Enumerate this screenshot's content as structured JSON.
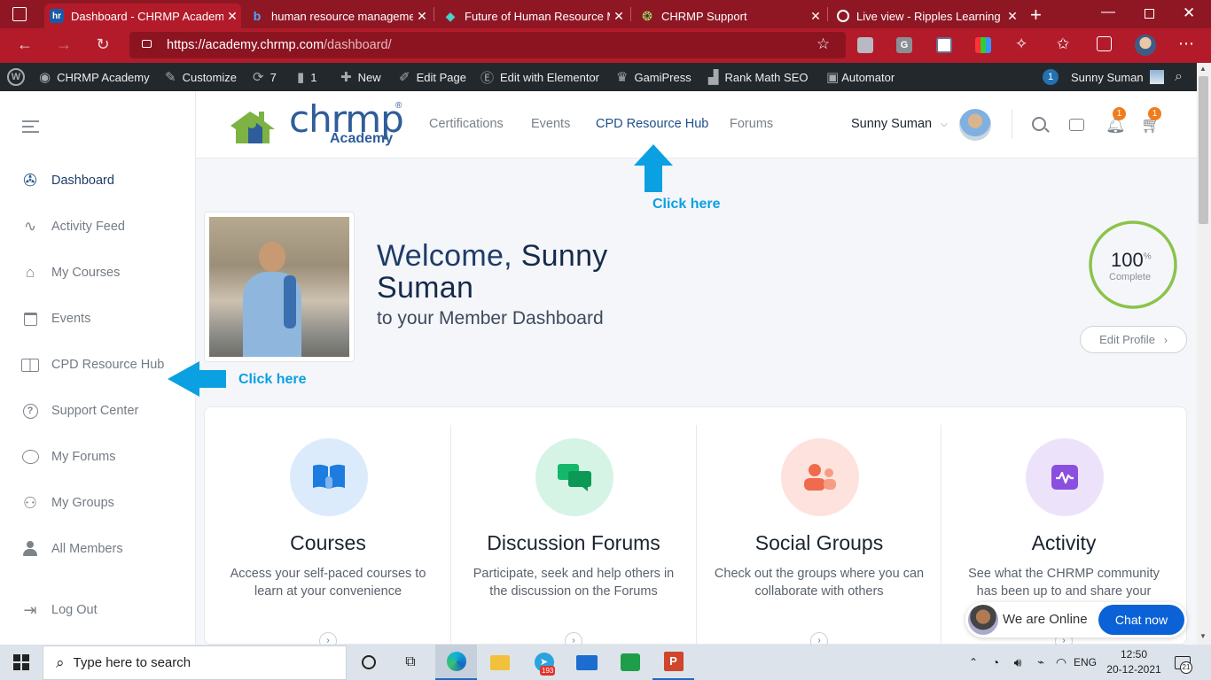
{
  "browser": {
    "tabs": [
      {
        "favicon": "hr",
        "title": "Dashboard - CHRMP Academ",
        "active": true
      },
      {
        "favicon": "bing-icon",
        "title": "human resource managemen",
        "active": false
      },
      {
        "favicon": "diamond-icon",
        "title": "Future of Human Resource M",
        "active": false
      },
      {
        "favicon": "chrmp-support-icon",
        "title": "CHRMP Support",
        "active": false
      },
      {
        "favicon": "ripples-icon",
        "title": "Live view - Ripples Learning",
        "active": false
      }
    ],
    "url_scheme": "https://",
    "url_host": "academy.chrmp.com",
    "url_path": "/dashboard/",
    "ext_g_label": "G"
  },
  "wpbar": {
    "site_name": "CHRMP Academy",
    "customize": "Customize",
    "updates_count": "7",
    "comments_count": "1",
    "new": "New",
    "edit_page": "Edit Page",
    "edit_elementor": "Edit with Elementor",
    "gamipress": "GamiPress",
    "rank_math": "Rank Math SEO",
    "automator": "Automator",
    "notif_count": "1",
    "user": "Sunny Suman"
  },
  "sidebar": {
    "items": [
      {
        "label": "Dashboard",
        "icon": "dashboard-icon",
        "active": true
      },
      {
        "label": "Activity Feed",
        "icon": "activity-icon",
        "active": false
      },
      {
        "label": "My Courses",
        "icon": "graduation-cap-icon",
        "active": false
      },
      {
        "label": "Events",
        "icon": "calendar-icon",
        "active": false
      },
      {
        "label": "CPD Resource Hub",
        "icon": "book-icon",
        "active": false
      },
      {
        "label": "Support Center",
        "icon": "help-icon",
        "active": false
      },
      {
        "label": "My Forums",
        "icon": "chat-icon",
        "active": false
      },
      {
        "label": "My Groups",
        "icon": "groups-icon",
        "active": false
      },
      {
        "label": "All Members",
        "icon": "member-icon",
        "active": false
      }
    ],
    "logout": "Log Out"
  },
  "header": {
    "logo_main": "chrmp",
    "logo_sub": "Academy",
    "logo_reg": "®",
    "nav": [
      "Certifications",
      "Events",
      "CPD Resource Hub",
      "Forums"
    ],
    "user_name": "Sunny Suman",
    "notif_badge": "1",
    "cart_badge": "1"
  },
  "annotations": {
    "click_here_top": "Click here",
    "click_here_left": "Click here",
    "arrow_color": "#0aa0e2"
  },
  "welcome": {
    "greeting": "Welcome,",
    "first_name": "Sunny",
    "last_name": "Suman",
    "subtitle": "to your Member Dashboard",
    "progress_value": "100",
    "progress_unit": "%",
    "progress_label": "Complete",
    "progress_fraction": 1.0,
    "edit_profile": "Edit Profile"
  },
  "cards": [
    {
      "title": "Courses",
      "desc": "Access your self-paced courses to learn at your convenience",
      "icon": "open-book-icon",
      "bg": "#dcebfb",
      "fg": "#1d7ce0"
    },
    {
      "title": "Discussion Forums",
      "desc": "Participate, seek and help others in the discussion on the Forums",
      "icon": "chat-bubbles-icon",
      "bg": "#d6f4e6",
      "fg": "#14b86a"
    },
    {
      "title": "Social Groups",
      "desc": "Check out the groups where you can collaborate with others",
      "icon": "people-icon",
      "bg": "#fde2dd",
      "fg": "#f06a4c"
    },
    {
      "title": "Activity",
      "desc": "See what the CHRMP community has been up to and share your",
      "icon": "activity-wave-icon",
      "bg": "#ece3fb",
      "fg": "#8b4fe0"
    }
  ],
  "chat": {
    "status": "We are Online",
    "button": "Chat now"
  },
  "taskbar": {
    "search_placeholder": "Type here to search",
    "telegram_badge": "193",
    "language": "ENG",
    "time": "12:50",
    "date": "20-12-2021",
    "notifications": "21"
  }
}
